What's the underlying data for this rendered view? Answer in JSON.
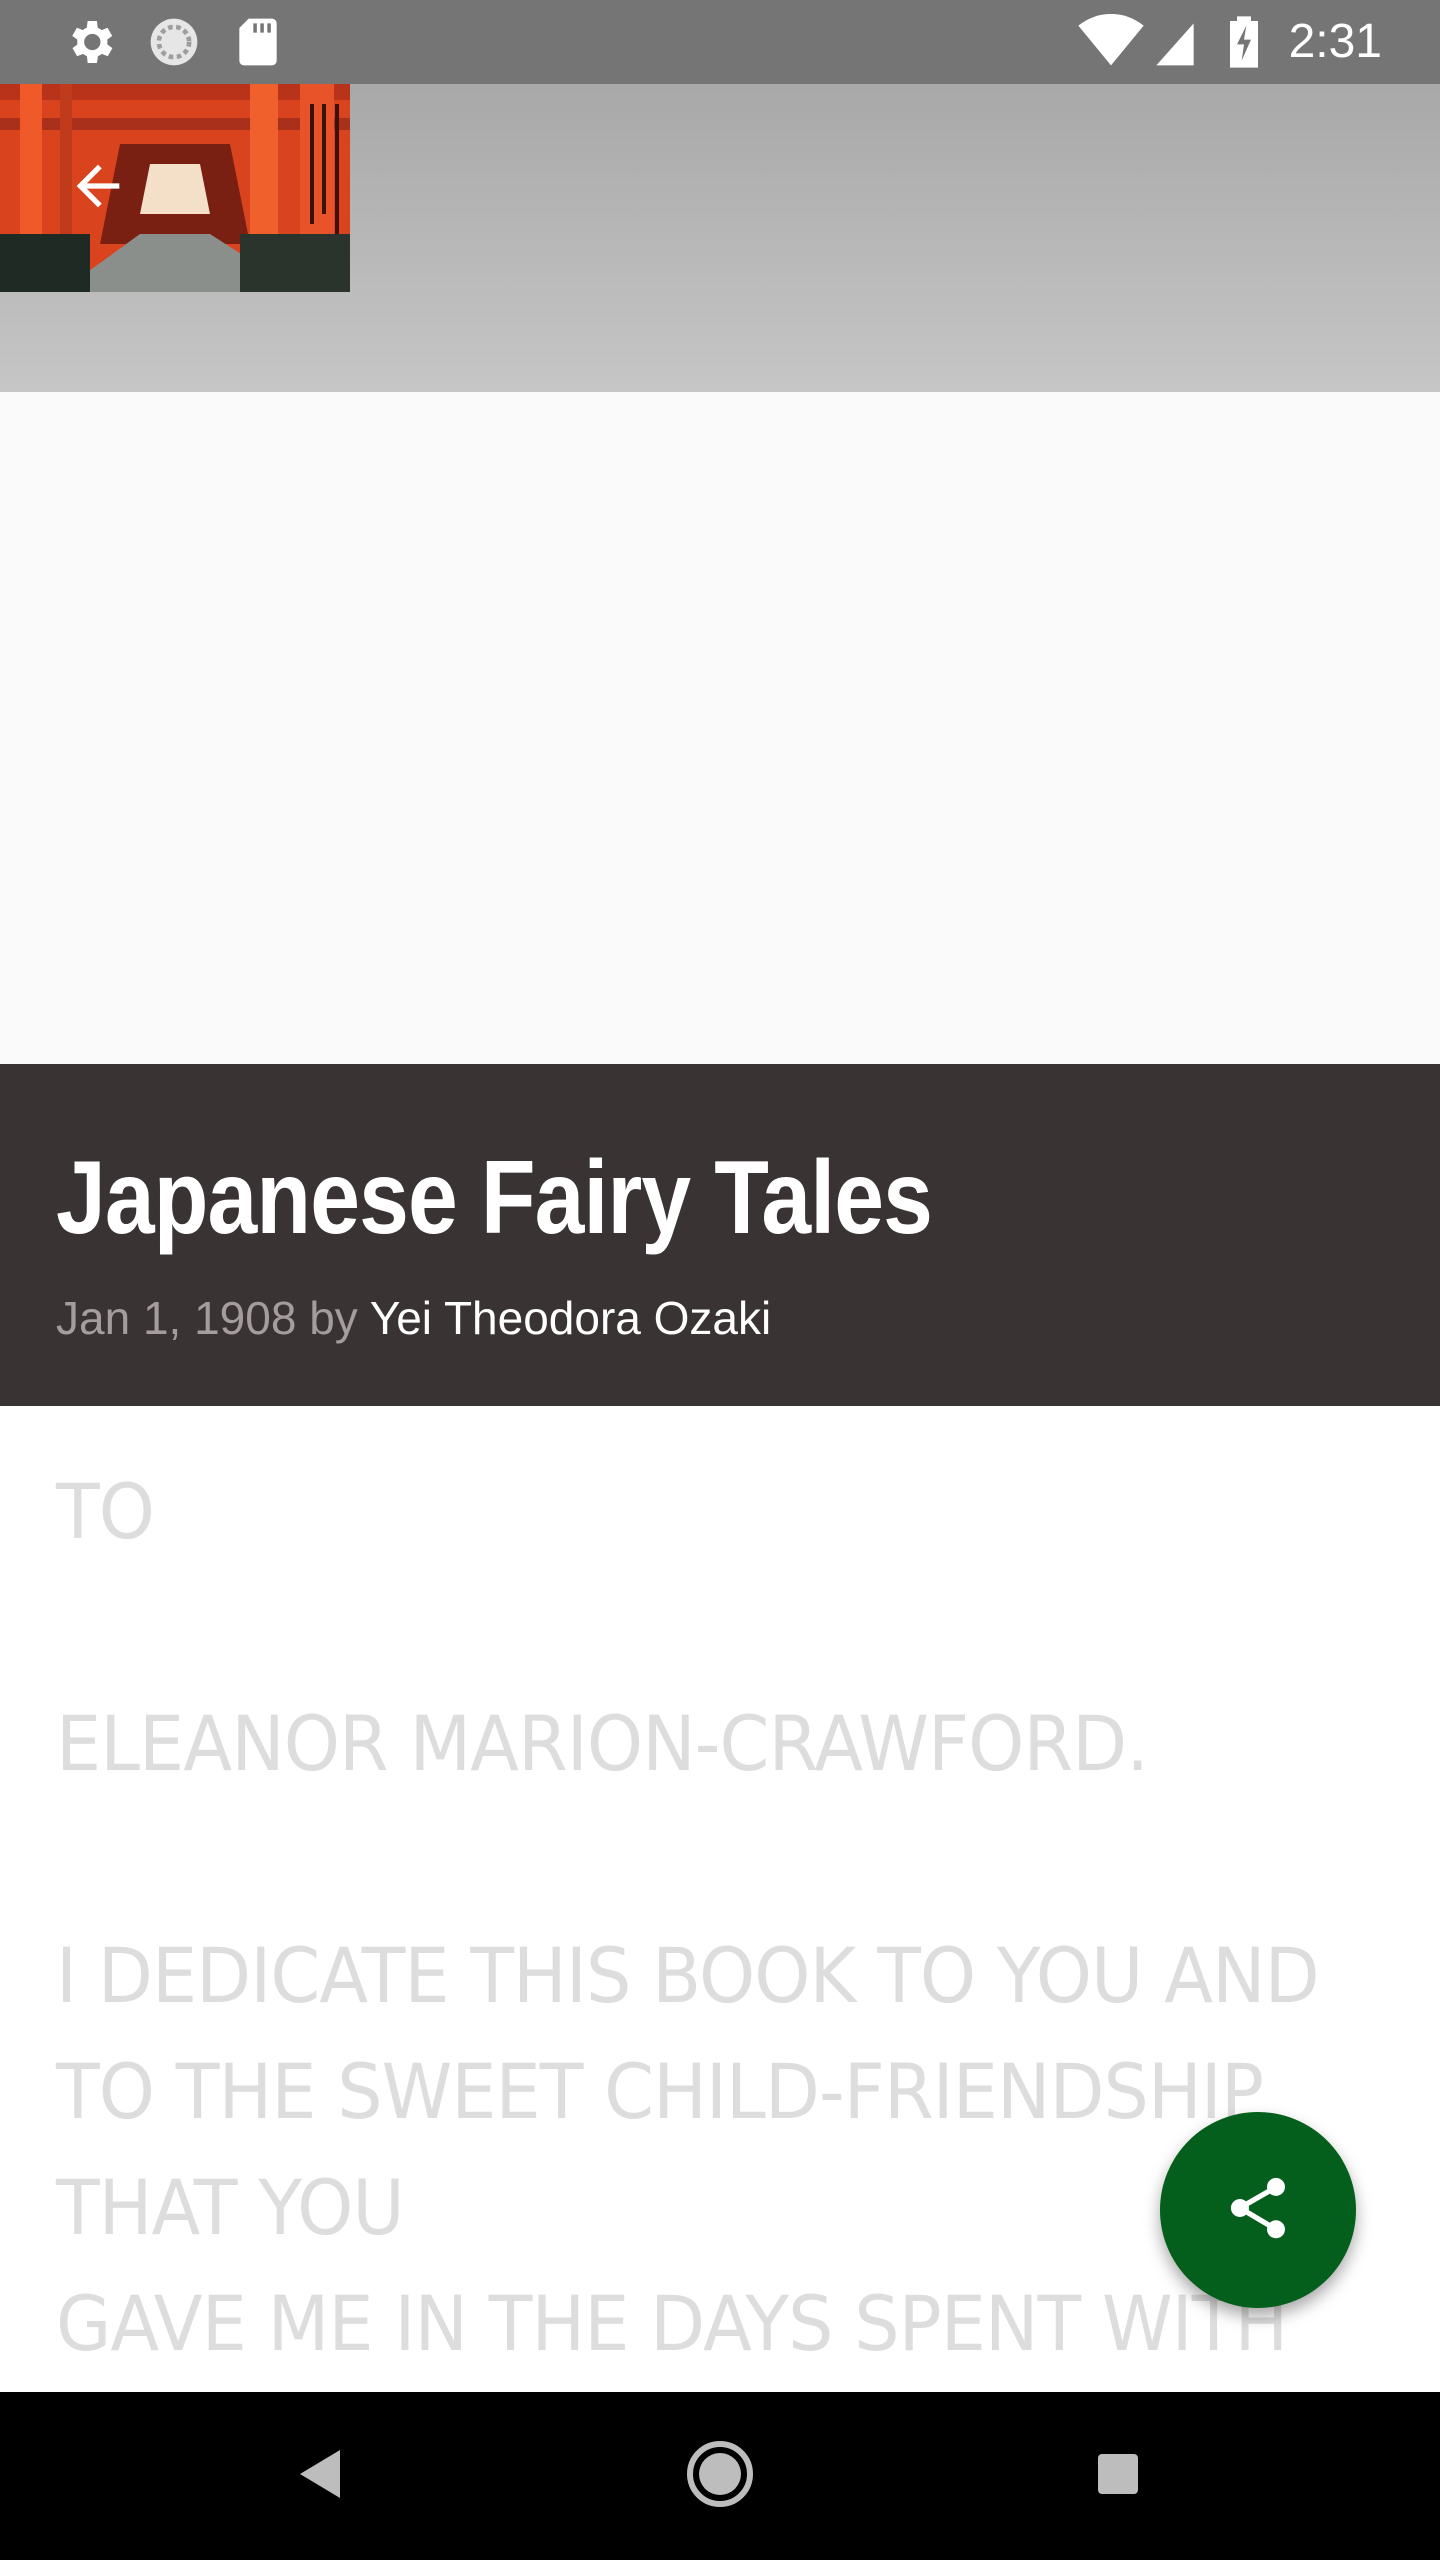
{
  "status_bar": {
    "time": "2:31",
    "left_icons": [
      "settings-icon",
      "sync-icon",
      "sd-card-icon"
    ],
    "right_icons": [
      "wifi-icon",
      "cell-signal-icon",
      "battery-charging-icon"
    ]
  },
  "header": {
    "thumbnail": "torii-gate-path-image",
    "back_icon": "arrow-back-icon"
  },
  "book": {
    "title": "Japanese Fairy Tales",
    "date": "Jan 1, 1908",
    "by": "by",
    "author": "Yei Theodora Ozaki"
  },
  "content": {
    "line1": "TO",
    "line2": "ELEANOR MARION-CRAWFORD.",
    "line3": "I DEDICATE THIS BOOK TO YOU AND",
    "line4": "TO THE SWEET CHILD-FRIENDSHIP",
    "line5": "THAT YOU",
    "line6": "GAVE ME IN THE DAYS SPENT WITH"
  },
  "fab": {
    "icon": "share-icon",
    "color": "#045f1c"
  },
  "nav_bar": {
    "icons": [
      "back-triangle-icon",
      "home-circle-icon",
      "recents-square-icon"
    ]
  },
  "colors": {
    "title_card_bg": "#3a3334",
    "status_bar_bg": "#757575",
    "body_text": "#dddddd"
  }
}
